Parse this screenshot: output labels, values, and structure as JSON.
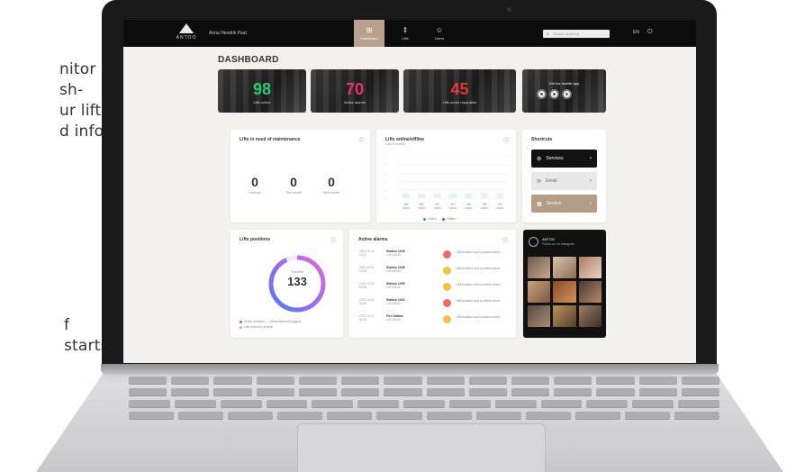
{
  "side_text": {
    "upper": [
      "nitor",
      "sh-",
      "ur lifts",
      "d infor-"
    ],
    "lower": [
      "f starts"
    ]
  },
  "topbar": {
    "logo_text": "ANTOO",
    "user_name": "Anna Hendrik Paal",
    "nav": [
      {
        "label": "Dashboard",
        "icon": "grid-icon",
        "active": true
      },
      {
        "label": "Lifts",
        "icon": "lift-icon",
        "active": false
      },
      {
        "label": "Users",
        "icon": "users-icon",
        "active": false
      }
    ],
    "search_placeholder": "Search anything",
    "language": "EN",
    "accent_color": "#b8a18c"
  },
  "page_title": "DASHBOARD",
  "stats": [
    {
      "value": "98",
      "label": "Lifts online",
      "color": "#2ecc71"
    },
    {
      "value": "70",
      "label": "Active alarms",
      "color": "#e8336a"
    },
    {
      "value": "45",
      "label": "Lifts under reparation",
      "color": "#e53935"
    }
  ],
  "app_card": {
    "title": "Get the mobile app"
  },
  "maintenance": {
    "title": "Lifts in need of maintenance",
    "items": [
      {
        "value": "0",
        "label": "Overdue"
      },
      {
        "value": "0",
        "label": "This month"
      },
      {
        "value": "0",
        "label": "Next month"
      }
    ]
  },
  "online_chart": {
    "title": "Lifts online/offline",
    "subtitle": "Last 6 months",
    "legend": [
      "Online",
      "Offline"
    ]
  },
  "chart_data": {
    "type": "bar",
    "title": "Lifts online/offline",
    "categories": [
      "98",
      "96",
      "97",
      "97",
      "98",
      "98",
      "97"
    ],
    "series": [
      {
        "name": "Online",
        "values": [
          98,
          96,
          97,
          97,
          98,
          98,
          97
        ],
        "color": "#26b38a"
      },
      {
        "name": "Offline",
        "values": [
          2,
          4,
          3,
          3,
          2,
          2,
          3
        ],
        "color": "#e53935"
      }
    ],
    "ylim": [
      0,
      100
    ],
    "grid": true,
    "legend_placement": "bottom"
  },
  "shortcuts": {
    "title": "Shortcuts",
    "items": [
      {
        "label": "Services",
        "icon": "wrench-icon",
        "style": "dark"
      },
      {
        "label": "Email",
        "icon": "mail-icon",
        "style": "light"
      },
      {
        "label": "Service",
        "icon": "calendar-icon",
        "style": "brown"
      }
    ]
  },
  "positions": {
    "title": "Lifts positions",
    "center_label": "Total lifts",
    "total": "133",
    "legend": [
      "Active locations — Online/Sensor/Engaged",
      "Lifts moved in service"
    ],
    "ring_color": "#7c6cf0"
  },
  "alarms": {
    "title": "Active alarms",
    "rows": [
      {
        "date": "2023-10-01 10:21",
        "name": "Station 1049",
        "place": "Lift 45A46",
        "status": "red",
        "text": "Lift/Escalator doors position alarm"
      },
      {
        "date": "2023-10-01 10:15",
        "name": "Station 1048",
        "place": "Lift 45A46",
        "status": "yellow",
        "text": "Lift/Escalator doors position alarm"
      },
      {
        "date": "2023-10-01 09:58",
        "name": "Station 1039",
        "place": "Lift 45A46",
        "status": "yellow",
        "text": "Lift/Escalator doors position alarm"
      },
      {
        "date": "2023-10-01 09:40",
        "name": "Station 1022",
        "place": "Lift 45A46",
        "status": "red",
        "text": "Lift/Escalator doors position alarm"
      },
      {
        "date": "2023-10-01 09:12",
        "name": "Fire Station",
        "place": "Lift 45A46",
        "status": "yellow",
        "text": "Lift/Escalator doors position alarm"
      }
    ]
  },
  "gallery": {
    "name": "ANTOO",
    "subtitle": "Follow us on Instagram"
  }
}
